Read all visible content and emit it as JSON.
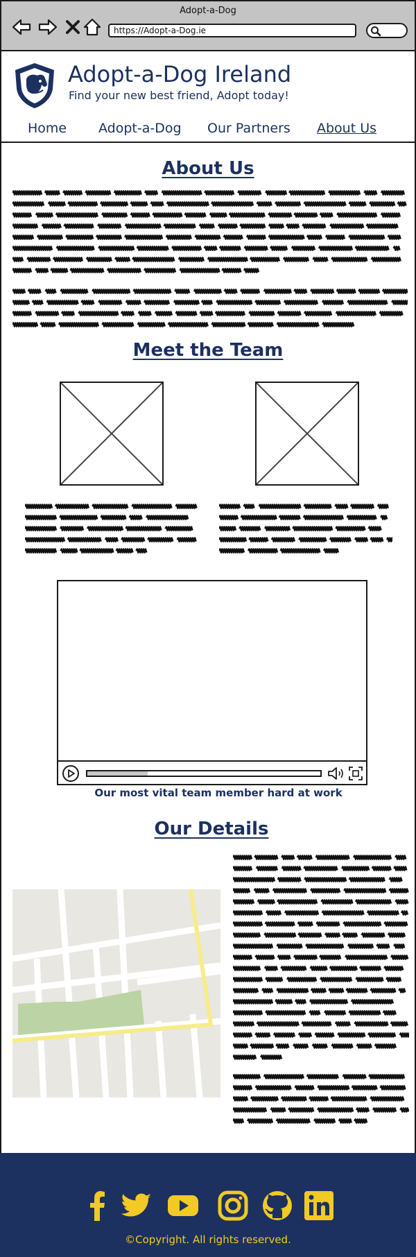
{
  "browser": {
    "window_title": "Adopt-a-Dog",
    "url": "https://Adopt-a-Dog.ie"
  },
  "header": {
    "site_title": "Adopt-a-Dog Ireland",
    "tagline": "Find your new best friend, Adopt today!",
    "logo_icon": "dog-shield-logo"
  },
  "nav": {
    "items": [
      {
        "label": "Home"
      },
      {
        "label": "Adopt-a-Dog"
      },
      {
        "label": "Our Partners"
      },
      {
        "label": "About Us"
      }
    ],
    "active": "About Us"
  },
  "about": {
    "heading": "About Us"
  },
  "team": {
    "heading": "Meet the Team",
    "video_caption": "Our most vital team member hard at work",
    "video_progress_fraction": 0.26
  },
  "details": {
    "heading": "Our Details"
  },
  "footer": {
    "copyright": "©Copyright. All rights reserved.",
    "social_icons": [
      "facebook-icon",
      "twitter-icon",
      "youtube-icon",
      "instagram-icon",
      "github-icon",
      "linkedin-icon"
    ]
  },
  "colors": {
    "brand_navy": "#1c3160",
    "accent_yellow": "#f2c925",
    "chrome_gray": "#c4c4c4"
  }
}
